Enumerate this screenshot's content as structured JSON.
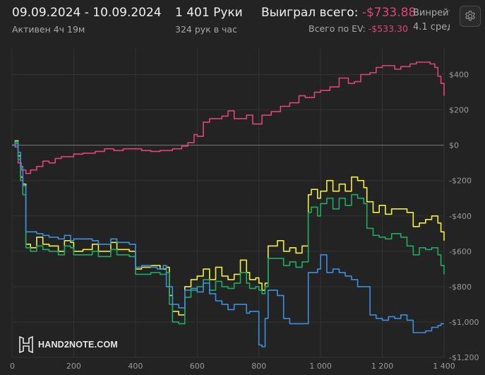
{
  "header": {
    "date_range": "09.09.2024 - 10.09.2024",
    "active_time": "Активен 4ч 19м",
    "hands_count": "1 401 Руки",
    "hands_per_hour": "324 рук в час",
    "won_total_label": "Выиграл всего:",
    "won_total_value": "-$733.88",
    "ev_total_label": "Всего по EV:",
    "ev_total_value": "-$533.30",
    "winrate_label": "Винрейт",
    "winrate_value": "4.1 сред"
  },
  "icons": {
    "settings": "gear-icon",
    "logo": "hand2note-logo"
  },
  "logo": {
    "text": "HAND2NOTE.COM"
  },
  "colors": {
    "background": "#232323",
    "pink_line": "#e0457a",
    "yellow_line": "#f2f03a",
    "green_line": "#1eac63",
    "blue_line": "#3d8fe0",
    "grid": "#333333",
    "zero_line": "#7a7a7a"
  },
  "chart_data": {
    "type": "line",
    "xlim": [
      0,
      1400
    ],
    "ylim": [
      -1200,
      550
    ],
    "x_ticks": [
      0,
      200,
      400,
      600,
      800,
      1000,
      1200,
      1400
    ],
    "x_tick_labels": [
      "0",
      "200",
      "400",
      "600",
      "800",
      "1 000",
      "1 200",
      "1 400"
    ],
    "y_ticks": [
      400,
      200,
      0,
      -200,
      -400,
      -600,
      -800,
      -1000,
      -1200
    ],
    "y_tick_labels": [
      "$400",
      "$200",
      "$0",
      "-$200",
      "-$400",
      "-$600",
      "-$800",
      "-$1,000",
      "-$1,200"
    ],
    "grid": true,
    "series": [
      {
        "color": "#e0457a",
        "points": [
          [
            0,
            0
          ],
          [
            10,
            -10
          ],
          [
            20,
            -100
          ],
          [
            30,
            -140
          ],
          [
            45,
            -160
          ],
          [
            60,
            -140
          ],
          [
            80,
            -120
          ],
          [
            100,
            -90
          ],
          [
            120,
            -100
          ],
          [
            140,
            -75
          ],
          [
            160,
            -65
          ],
          [
            200,
            -50
          ],
          [
            230,
            -45
          ],
          [
            270,
            -35
          ],
          [
            300,
            -20
          ],
          [
            330,
            -30
          ],
          [
            360,
            -20
          ],
          [
            400,
            -20
          ],
          [
            420,
            -30
          ],
          [
            450,
            -35
          ],
          [
            480,
            -30
          ],
          [
            520,
            -20
          ],
          [
            550,
            -5
          ],
          [
            570,
            15
          ],
          [
            590,
            60
          ],
          [
            600,
            50
          ],
          [
            620,
            130
          ],
          [
            640,
            150
          ],
          [
            680,
            165
          ],
          [
            700,
            195
          ],
          [
            720,
            150
          ],
          [
            760,
            170
          ],
          [
            780,
            120
          ],
          [
            810,
            170
          ],
          [
            840,
            190
          ],
          [
            870,
            220
          ],
          [
            900,
            240
          ],
          [
            930,
            280
          ],
          [
            950,
            270
          ],
          [
            980,
            300
          ],
          [
            1000,
            310
          ],
          [
            1030,
            330
          ],
          [
            1060,
            380
          ],
          [
            1090,
            350
          ],
          [
            1110,
            360
          ],
          [
            1130,
            400
          ],
          [
            1160,
            410
          ],
          [
            1180,
            440
          ],
          [
            1200,
            450
          ],
          [
            1240,
            430
          ],
          [
            1260,
            445
          ],
          [
            1290,
            460
          ],
          [
            1310,
            470
          ],
          [
            1340,
            470
          ],
          [
            1355,
            460
          ],
          [
            1370,
            440
          ],
          [
            1380,
            390
          ],
          [
            1390,
            350
          ],
          [
            1400,
            280
          ]
        ]
      },
      {
        "color": "#f2f03a",
        "points": [
          [
            0,
            0
          ],
          [
            10,
            25
          ],
          [
            20,
            -60
          ],
          [
            28,
            -180
          ],
          [
            35,
            -220
          ],
          [
            45,
            -560
          ],
          [
            60,
            -580
          ],
          [
            80,
            -520
          ],
          [
            100,
            -560
          ],
          [
            120,
            -570
          ],
          [
            150,
            -600
          ],
          [
            170,
            -540
          ],
          [
            190,
            -550
          ],
          [
            200,
            -600
          ],
          [
            230,
            -590
          ],
          [
            260,
            -560
          ],
          [
            280,
            -600
          ],
          [
            320,
            -550
          ],
          [
            340,
            -590
          ],
          [
            380,
            -600
          ],
          [
            400,
            -700
          ],
          [
            420,
            -690
          ],
          [
            450,
            -680
          ],
          [
            480,
            -700
          ],
          [
            500,
            -690
          ],
          [
            510,
            -850
          ],
          [
            520,
            -940
          ],
          [
            540,
            -960
          ],
          [
            560,
            -800
          ],
          [
            580,
            -760
          ],
          [
            600,
            -740
          ],
          [
            620,
            -700
          ],
          [
            640,
            -760
          ],
          [
            660,
            -690
          ],
          [
            680,
            -740
          ],
          [
            700,
            -760
          ],
          [
            720,
            -730
          ],
          [
            740,
            -650
          ],
          [
            760,
            -720
          ],
          [
            770,
            -760
          ],
          [
            790,
            -750
          ],
          [
            800,
            -780
          ],
          [
            810,
            -820
          ],
          [
            820,
            -780
          ],
          [
            830,
            -570
          ],
          [
            860,
            -540
          ],
          [
            880,
            -600
          ],
          [
            900,
            -580
          ],
          [
            920,
            -610
          ],
          [
            940,
            -570
          ],
          [
            960,
            -280
          ],
          [
            970,
            -250
          ],
          [
            990,
            -300
          ],
          [
            1000,
            -260
          ],
          [
            1020,
            -200
          ],
          [
            1040,
            -260
          ],
          [
            1060,
            -220
          ],
          [
            1080,
            -260
          ],
          [
            1100,
            -180
          ],
          [
            1120,
            -200
          ],
          [
            1140,
            -240
          ],
          [
            1150,
            -320
          ],
          [
            1170,
            -380
          ],
          [
            1190,
            -340
          ],
          [
            1210,
            -390
          ],
          [
            1230,
            -360
          ],
          [
            1260,
            -360
          ],
          [
            1280,
            -380
          ],
          [
            1300,
            -460
          ],
          [
            1320,
            -440
          ],
          [
            1340,
            -420
          ],
          [
            1360,
            -400
          ],
          [
            1380,
            -440
          ],
          [
            1390,
            -490
          ],
          [
            1400,
            -540
          ]
        ]
      },
      {
        "color": "#1eac63",
        "points": [
          [
            0,
            0
          ],
          [
            10,
            20
          ],
          [
            20,
            -80
          ],
          [
            28,
            -200
          ],
          [
            35,
            -280
          ],
          [
            45,
            -580
          ],
          [
            60,
            -600
          ],
          [
            80,
            -570
          ],
          [
            100,
            -590
          ],
          [
            120,
            -600
          ],
          [
            150,
            -620
          ],
          [
            170,
            -570
          ],
          [
            190,
            -580
          ],
          [
            200,
            -620
          ],
          [
            230,
            -620
          ],
          [
            260,
            -600
          ],
          [
            280,
            -630
          ],
          [
            320,
            -590
          ],
          [
            340,
            -620
          ],
          [
            380,
            -630
          ],
          [
            400,
            -730
          ],
          [
            420,
            -730
          ],
          [
            450,
            -720
          ],
          [
            480,
            -730
          ],
          [
            500,
            -720
          ],
          [
            510,
            -900
          ],
          [
            520,
            -1000
          ],
          [
            540,
            -1010
          ],
          [
            560,
            -860
          ],
          [
            580,
            -820
          ],
          [
            600,
            -800
          ],
          [
            620,
            -760
          ],
          [
            640,
            -820
          ],
          [
            660,
            -770
          ],
          [
            680,
            -800
          ],
          [
            700,
            -810
          ],
          [
            720,
            -780
          ],
          [
            740,
            -720
          ],
          [
            760,
            -780
          ],
          [
            770,
            -810
          ],
          [
            790,
            -800
          ],
          [
            800,
            -820
          ],
          [
            810,
            -840
          ],
          [
            820,
            -800
          ],
          [
            830,
            -640
          ],
          [
            860,
            -640
          ],
          [
            880,
            -680
          ],
          [
            900,
            -660
          ],
          [
            920,
            -690
          ],
          [
            940,
            -660
          ],
          [
            960,
            -380
          ],
          [
            970,
            -350
          ],
          [
            990,
            -400
          ],
          [
            1000,
            -330
          ],
          [
            1020,
            -300
          ],
          [
            1040,
            -360
          ],
          [
            1060,
            -300
          ],
          [
            1080,
            -340
          ],
          [
            1100,
            -280
          ],
          [
            1120,
            -300
          ],
          [
            1140,
            -330
          ],
          [
            1150,
            -470
          ],
          [
            1170,
            -510
          ],
          [
            1190,
            -520
          ],
          [
            1210,
            -530
          ],
          [
            1230,
            -500
          ],
          [
            1260,
            -520
          ],
          [
            1280,
            -570
          ],
          [
            1300,
            -620
          ],
          [
            1320,
            -580
          ],
          [
            1340,
            -590
          ],
          [
            1360,
            -580
          ],
          [
            1380,
            -620
          ],
          [
            1390,
            -680
          ],
          [
            1400,
            -730
          ]
        ]
      },
      {
        "color": "#3d8fe0",
        "points": [
          [
            0,
            0
          ],
          [
            10,
            10
          ],
          [
            20,
            -40
          ],
          [
            28,
            -120
          ],
          [
            35,
            -230
          ],
          [
            45,
            -490
          ],
          [
            60,
            -490
          ],
          [
            80,
            -500
          ],
          [
            100,
            -510
          ],
          [
            120,
            -520
          ],
          [
            150,
            -530
          ],
          [
            170,
            -510
          ],
          [
            190,
            -540
          ],
          [
            200,
            -530
          ],
          [
            230,
            -530
          ],
          [
            260,
            -540
          ],
          [
            280,
            -560
          ],
          [
            320,
            -530
          ],
          [
            340,
            -550
          ],
          [
            380,
            -560
          ],
          [
            400,
            -690
          ],
          [
            420,
            -680
          ],
          [
            450,
            -690
          ],
          [
            470,
            -700
          ],
          [
            490,
            -680
          ],
          [
            500,
            -800
          ],
          [
            520,
            -900
          ],
          [
            540,
            -920
          ],
          [
            560,
            -820
          ],
          [
            580,
            -810
          ],
          [
            600,
            -830
          ],
          [
            620,
            -780
          ],
          [
            640,
            -840
          ],
          [
            660,
            -880
          ],
          [
            680,
            -900
          ],
          [
            700,
            -930
          ],
          [
            720,
            -900
          ],
          [
            740,
            -900
          ],
          [
            760,
            -950
          ],
          [
            770,
            -940
          ],
          [
            790,
            -940
          ],
          [
            800,
            -1130
          ],
          [
            810,
            -1140
          ],
          [
            820,
            -980
          ],
          [
            830,
            -820
          ],
          [
            860,
            -850
          ],
          [
            880,
            -980
          ],
          [
            900,
            -1010
          ],
          [
            920,
            -1010
          ],
          [
            940,
            -1010
          ],
          [
            960,
            -720
          ],
          [
            970,
            -720
          ],
          [
            990,
            -700
          ],
          [
            1000,
            -620
          ],
          [
            1020,
            -720
          ],
          [
            1040,
            -700
          ],
          [
            1060,
            -720
          ],
          [
            1080,
            -740
          ],
          [
            1100,
            -760
          ],
          [
            1120,
            -800
          ],
          [
            1140,
            -800
          ],
          [
            1160,
            -960
          ],
          [
            1180,
            -980
          ],
          [
            1200,
            -990
          ],
          [
            1220,
            -970
          ],
          [
            1240,
            -980
          ],
          [
            1260,
            -960
          ],
          [
            1280,
            -990
          ],
          [
            1300,
            -1060
          ],
          [
            1320,
            -1060
          ],
          [
            1340,
            -1050
          ],
          [
            1360,
            -1030
          ],
          [
            1380,
            -1020
          ],
          [
            1390,
            -1010
          ],
          [
            1400,
            -1010
          ]
        ]
      }
    ]
  }
}
